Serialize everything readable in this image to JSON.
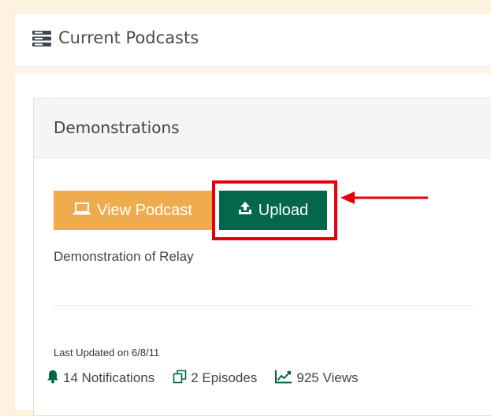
{
  "header": {
    "icon": "server-stack-icon",
    "title": "Current Podcasts"
  },
  "podcast": {
    "title": "Demonstrations",
    "view_button": {
      "icon": "laptop-icon",
      "label": "View Podcast",
      "color": "#efac4e"
    },
    "upload_button": {
      "icon": "upload-icon",
      "label": "Upload",
      "color": "#04674a"
    },
    "description": "Demonstration of Relay",
    "last_updated": "Last Updated on 6/8/11",
    "stats": {
      "notifications": {
        "icon": "bell-icon",
        "label": "14 Notifications"
      },
      "episodes": {
        "icon": "copy-icon",
        "label": "2 Episodes"
      },
      "views": {
        "icon": "line-chart-icon",
        "label": "925 Views"
      }
    }
  },
  "annotation": {
    "highlight_color": "#e3000b",
    "arrow_color": "#e3000b"
  }
}
